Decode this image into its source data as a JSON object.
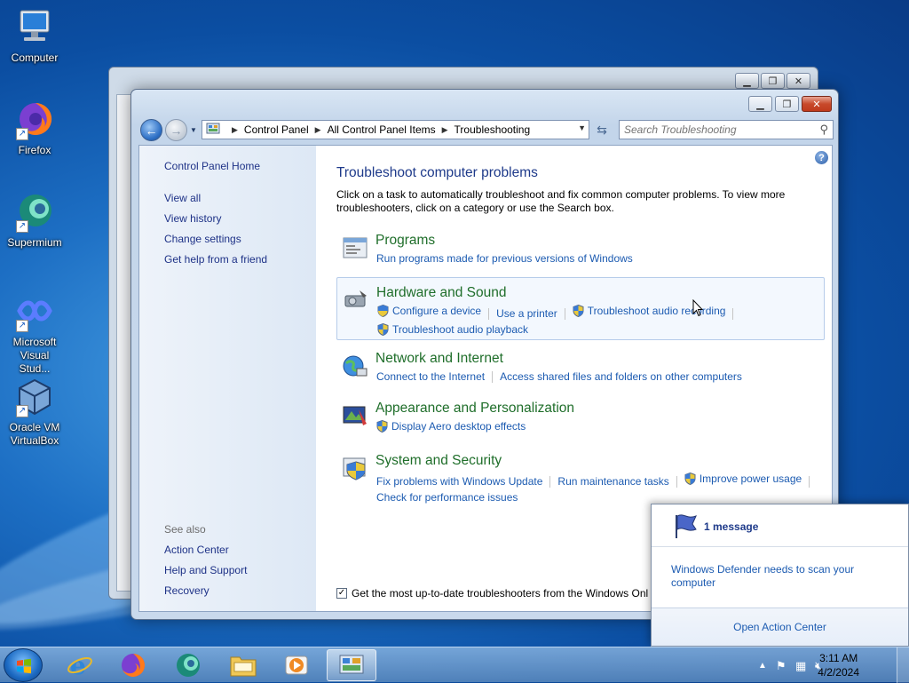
{
  "desktop": {
    "icons": [
      {
        "label": "Computer",
        "icon": "computer-icon"
      },
      {
        "label": "Firefox",
        "icon": "firefox-icon"
      },
      {
        "label": "Supermium",
        "icon": "supermium-icon"
      },
      {
        "label": "Microsoft Visual Stud...",
        "icon": "visual-studio-icon"
      },
      {
        "label": "Oracle VM VirtualBox",
        "icon": "virtualbox-icon"
      }
    ]
  },
  "window": {
    "caption_buttons": [
      "minimize",
      "maximize",
      "close"
    ],
    "breadcrumb": [
      "Control Panel",
      "All Control Panel Items",
      "Troubleshooting"
    ],
    "search_placeholder": "Search Troubleshooting",
    "left_nav": {
      "home": "Control Panel Home",
      "links": [
        "View all",
        "View history",
        "Change settings",
        "Get help from a friend"
      ],
      "see_also_label": "See also",
      "see_also": [
        "Action Center",
        "Help and Support",
        "Recovery"
      ]
    },
    "main": {
      "title": "Troubleshoot computer problems",
      "intro": "Click on a task to automatically troubleshoot and fix common computer problems. To view more troubleshooters, click on a category or use the Search box.",
      "categories": [
        {
          "name": "Programs",
          "links": [
            "Run programs made for previous versions of Windows"
          ]
        },
        {
          "name": "Hardware and Sound",
          "links": [
            "Configure a device",
            "Use a printer",
            "Troubleshoot audio recording",
            "Troubleshoot audio playback"
          ]
        },
        {
          "name": "Network and Internet",
          "links": [
            "Connect to the Internet",
            "Access shared files and folders on other computers"
          ]
        },
        {
          "name": "Appearance and Personalization",
          "links": [
            "Display Aero desktop effects"
          ]
        },
        {
          "name": "System and Security",
          "links": [
            "Fix problems with Windows Update",
            "Run maintenance tasks",
            "Improve power usage",
            "Check for performance issues"
          ]
        }
      ],
      "checkbox_label": "Get the most up-to-date troubleshooters from the Windows Onl",
      "checkbox_checked": true
    }
  },
  "notification": {
    "count_text": "1 message",
    "message": "Windows Defender needs to scan your computer",
    "footer_link": "Open Action Center"
  },
  "taskbar": {
    "apps": [
      "internet-explorer",
      "firefox",
      "supermium",
      "file-explorer",
      "media-player",
      "control-panel"
    ],
    "active_app": "control-panel",
    "clock_time": "3:11 AM",
    "clock_date": "4/2/2024"
  },
  "colors": {
    "link": "#1c5bb1",
    "category": "#1f6e2a",
    "heading": "#1e3a8a"
  }
}
